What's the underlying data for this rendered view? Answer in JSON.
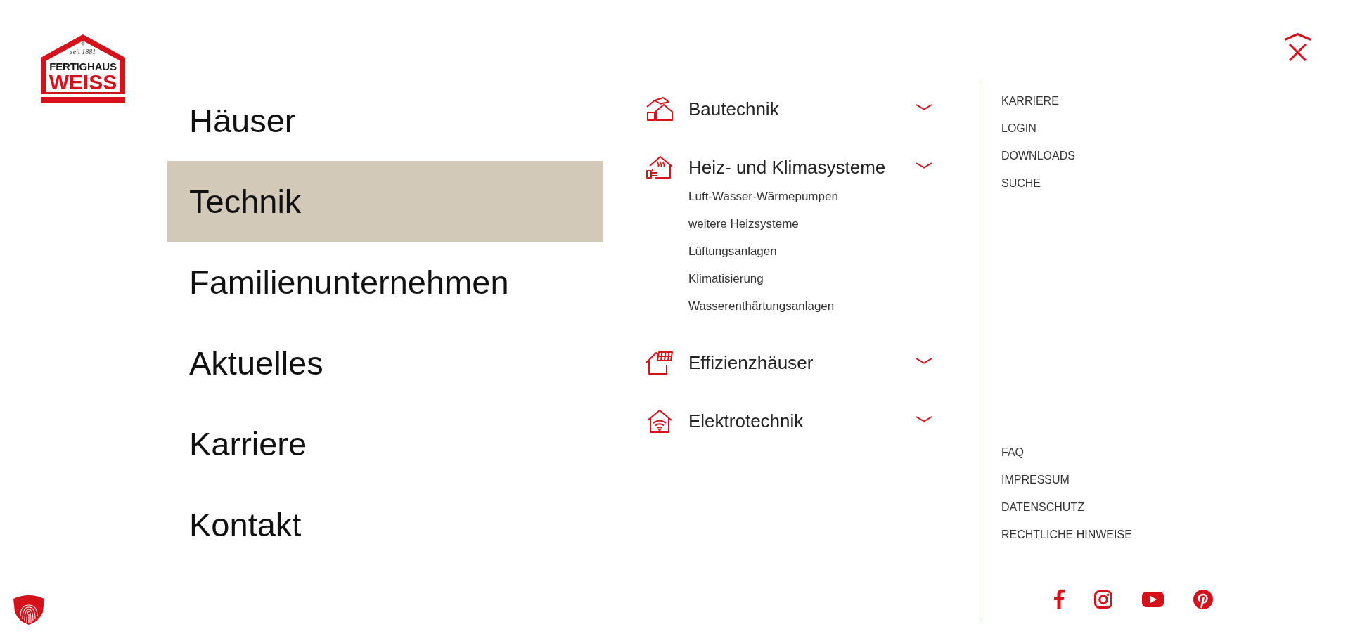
{
  "logo": {
    "trademark": "®",
    "tagline": "seit 1881",
    "wordmark": "FERTIGHAUS",
    "brand": "WEISS"
  },
  "main_nav": [
    {
      "label": "Häuser",
      "selected": false
    },
    {
      "label": "Technik",
      "selected": true
    },
    {
      "label": "Familienunternehmen",
      "selected": false
    },
    {
      "label": "Aktuelles",
      "selected": false
    },
    {
      "label": "Karriere",
      "selected": false
    },
    {
      "label": "Kontakt",
      "selected": false
    }
  ],
  "submenu": [
    {
      "kind": "construction",
      "label": "Bautechnik"
    },
    {
      "kind": "heating",
      "label": "Heiz- und Klimasysteme",
      "children": [
        "Luft-Wasser-Wärmepumpen",
        "weitere Heizsysteme",
        "Lüftungsanlagen",
        "Klimatisierung",
        "Wasserenthärtungsanlagen"
      ]
    },
    {
      "kind": "solar",
      "label": "Effizienzhäuser"
    },
    {
      "kind": "network",
      "label": "Elektrotechnik"
    }
  ],
  "service_links": [
    "KARRIERE",
    "LOGIN",
    "DOWNLOADS",
    "SUCHE"
  ],
  "legal_links": [
    "FAQ",
    "IMPRESSUM",
    "DATENSCHUTZ",
    "RECHTLICHE HINWEISE"
  ]
}
